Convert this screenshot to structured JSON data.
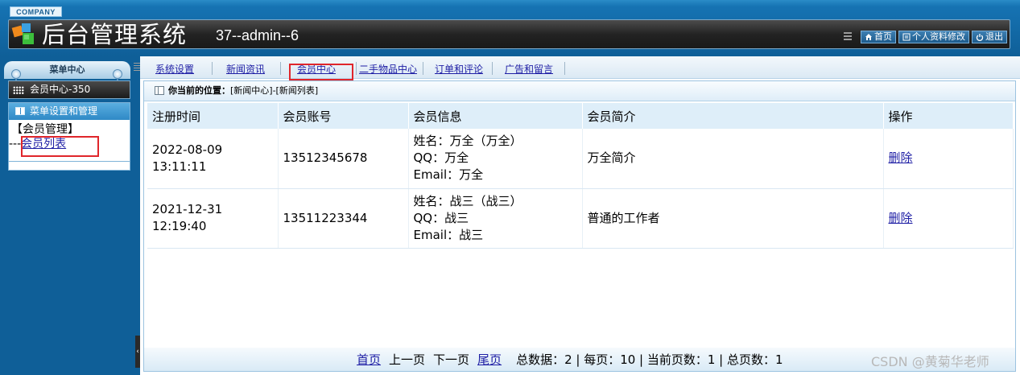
{
  "header": {
    "company": "COMPANY",
    "title": "后台管理系统",
    "user_info": "37--admin--6",
    "home_label": "首页",
    "profile_label": "个人资料修改",
    "logout_label": "退出"
  },
  "sidebar": {
    "menu_center": "菜单中心",
    "sub_title": "会员中心-350",
    "panel_title": "菜单设置和管理",
    "group_label": "【会员管理】",
    "link_prefix": "---",
    "link_label": "会员列表"
  },
  "nav": {
    "items": [
      "系统设置",
      "新闻资讯",
      "会员中心",
      "二手物品中心",
      "订单和评论",
      "广告和留言"
    ]
  },
  "breadcrumb": {
    "label": "你当前的位置：",
    "path": "[新闻中心]-[新闻列表]"
  },
  "table": {
    "headers": [
      "注册时间",
      "会员账号",
      "会员信息",
      "会员简介",
      "操作"
    ],
    "rows": [
      {
        "date": "2022-08-09",
        "time": "13:11:11",
        "account": "13512345678",
        "info_name": "姓名：万全（万全）",
        "info_qq": "QQ：万全",
        "info_email": "Email：万全",
        "intro": "万全简介",
        "action": "删除"
      },
      {
        "date": "2021-12-31",
        "time": "12:19:40",
        "account": "13511223344",
        "info_name": "姓名：战三（战三）",
        "info_qq": "QQ：战三",
        "info_email": "Email：战三",
        "intro": "普通的工作者",
        "action": "删除"
      }
    ]
  },
  "pager": {
    "first": "首页",
    "prev": "上一页",
    "next": "下一页",
    "last": "尾页",
    "stats": "总数据：2 | 每页：10 | 当前页数：1 | 总页数：1"
  },
  "watermark": "CSDN @黄菊华老师",
  "colors": {
    "header_blue": "#1673b3",
    "link_blue": "#1f1fa5",
    "highlight_red": "#e0262b"
  }
}
